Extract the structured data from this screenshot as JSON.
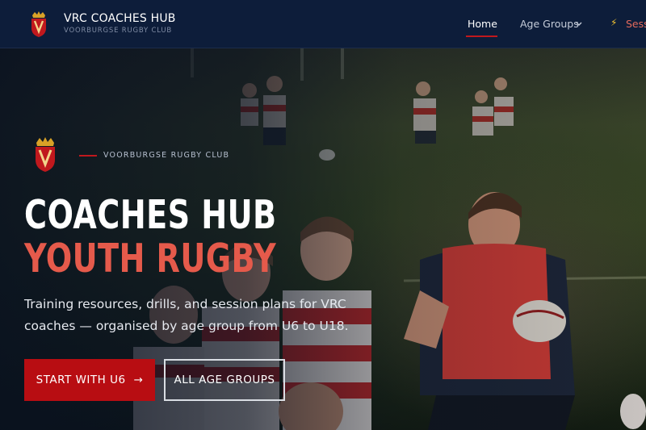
{
  "brand": {
    "title": "VRC COACHES HUB",
    "subtitle": "VOORBURGSE RUGBY CLUB",
    "logo_icon": "club-crest"
  },
  "nav": {
    "home": "Home",
    "age_groups": "Age Groups",
    "sessions_icon": "⚡",
    "sessions": "Sess"
  },
  "hero": {
    "eyebrow": "VOORBURGSE RUGBY CLUB",
    "title_line1": "COACHES HUB",
    "title_line2": "YOUTH RUGBY",
    "intro": "Training resources, drills, and session plans for VRC coaches — organised by age group from U6 to U18.",
    "primary_button": "START WITH U6",
    "primary_button_icon": "→",
    "secondary_button": "ALL AGE GROUPS"
  },
  "colors": {
    "navy": "#0d1d3a",
    "accent_red": "#c0181d",
    "title_red": "#e55a4b"
  }
}
